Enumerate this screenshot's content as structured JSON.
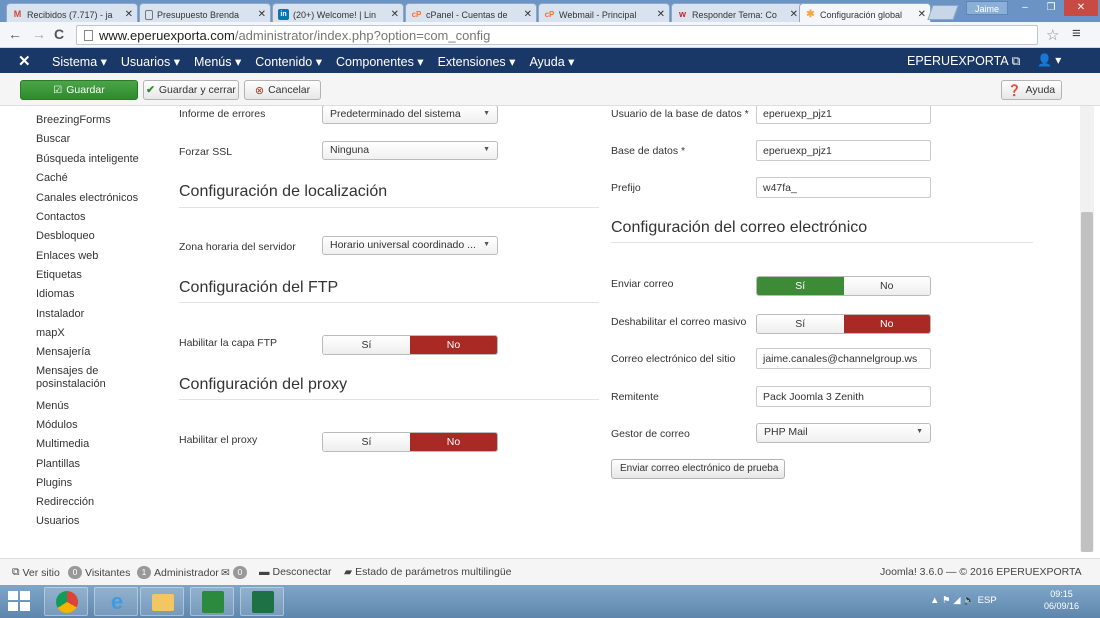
{
  "browser": {
    "tabs": [
      {
        "title": "Recibidos (7.717) - ja",
        "favicon": "M",
        "fav_color": "#d44638",
        "active": false
      },
      {
        "title": "Presupuesto Brenda",
        "favicon": "doc",
        "fav_color": "#555555",
        "active": false
      },
      {
        "title": "(20+) Welcome! | Lin",
        "favicon": "in",
        "fav_color": "#0077b5",
        "active": false
      },
      {
        "title": "cPanel - Cuentas de",
        "favicon": "cP",
        "fav_color": "#ff6c2c",
        "active": false
      },
      {
        "title": "Webmail - Principal",
        "favicon": "cP",
        "fav_color": "#ff6c2c",
        "active": false
      },
      {
        "title": "Responder Tema: Co",
        "favicon": "w",
        "fav_color": "#cc2222",
        "active": false
      },
      {
        "title": "Configuración global",
        "favicon": "J",
        "fav_color": "#f9a541",
        "active": true
      }
    ],
    "close_glyph": "✕",
    "user_chip": "Jaime",
    "url_host": "www.eperuexporta.com",
    "url_path": "/administrator/index.php?option=com_config"
  },
  "joomla_nav": {
    "menus": [
      "Sistema ▾",
      "Usuarios ▾",
      "Menús ▾",
      "Contenido ▾",
      "Componentes ▾",
      "Extensiones ▾",
      "Ayuda ▾"
    ],
    "site_name": "EPERUEXPORTA",
    "user_menu": "▾"
  },
  "toolbar": {
    "save": "Guardar",
    "save_close": "Guardar y cerrar",
    "cancel": "Cancelar",
    "help": "Ayuda"
  },
  "sidebar": {
    "items": [
      "BreezingForms",
      "Buscar",
      "Búsqueda inteligente",
      "Caché",
      "Canales electrónicos",
      "Contactos",
      "Desbloqueo",
      "Enlaces web",
      "Etiquetas",
      "Idiomas",
      "Instalador",
      "mapX",
      "Mensajería",
      "Mensajes de",
      "posinstalación",
      "Menús",
      "Módulos",
      "Multimedia",
      "Plantillas",
      "Plugins",
      "Redirección",
      "Usuarios"
    ]
  },
  "left_col": {
    "error_label": "Informe de errores",
    "error_value": "Predeterminado del sistema",
    "ssl_label": "Forzar SSL",
    "ssl_value": "Ninguna",
    "loc_heading": "Configuración de localización",
    "tz_label": "Zona horaria del servidor",
    "tz_value": "Horario universal coordinado ...",
    "ftp_heading": "Configuración del FTP",
    "ftp_label": "Habilitar la capa FTP",
    "proxy_heading": "Configuración del proxy",
    "proxy_label": "Habilitar el proxy",
    "yes": "Sí",
    "no": "No"
  },
  "right_col": {
    "dbuser_label": "Usuario de la base de datos *",
    "dbuser_value": "eperuexp_pjz1",
    "db_label": "Base de datos *",
    "db_value": "eperuexp_pjz1",
    "prefix_label": "Prefijo",
    "prefix_value": "w47fa_",
    "mail_heading": "Configuración del correo electrónico",
    "send_label": "Enviar correo",
    "mass_label": "Deshabilitar el correo masivo",
    "site_email_label": "Correo electrónico del sitio",
    "site_email_value": "jaime.canales@channelgroup.ws",
    "sender_label": "Remitente",
    "sender_value": "Pack Joomla 3 Zenith",
    "mailer_label": "Gestor de correo",
    "mailer_value": "PHP Mail",
    "test_button": "Enviar correo electrónico de prueba",
    "yes": "Sí",
    "no": "No"
  },
  "status": {
    "view_site": "Ver sitio",
    "visitors_count": "0",
    "visitors": "Visitantes",
    "admin_count": "1",
    "admin": "Administrador",
    "messages_count": "0",
    "logout": "Desconectar",
    "multilang": "Estado de parámetros multilingüe",
    "version": "Joomla! 3.6.0 — © 2016 EPERUEXPORTA"
  },
  "taskbar": {
    "lang": "ESP",
    "time": "09:15",
    "date": "06/09/16"
  },
  "colors": {
    "nav_bg": "#1a3867",
    "save_green": "#2e8b2c",
    "toggle_on_green": "#3d8b37",
    "toggle_on_red": "#a92a25"
  }
}
